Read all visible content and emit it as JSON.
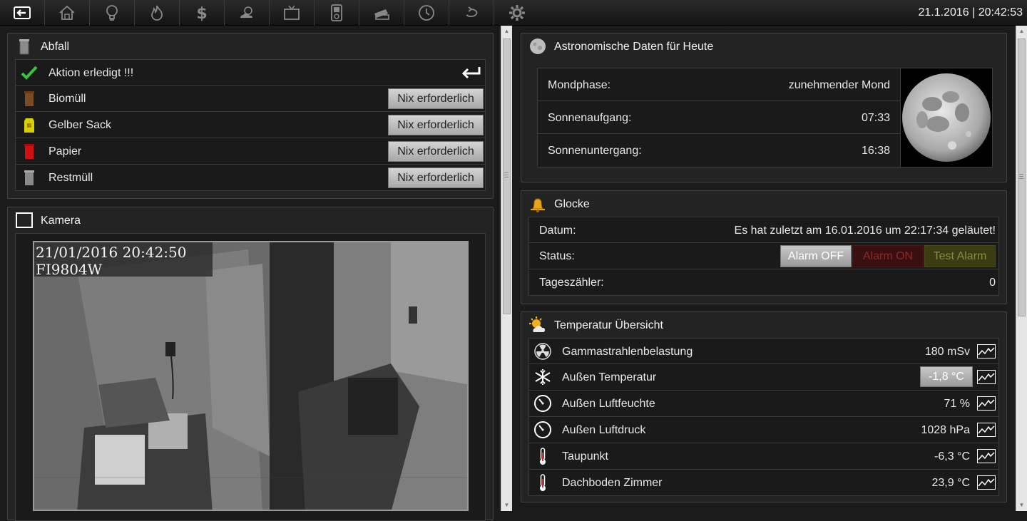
{
  "topbar": {
    "datetime": "21.1.2016 | 20:42:53",
    "nav": [
      "back-icon",
      "home-icon",
      "lightbulb-icon",
      "flame-icon",
      "dollar-icon",
      "weather-icon",
      "tv-icon",
      "media-player-icon",
      "tickets-icon",
      "clock-icon",
      "loop-icon",
      "gear-icon"
    ]
  },
  "abfall": {
    "title": "Abfall",
    "action_label": "Aktion erledigt !!!",
    "rows": [
      {
        "label": "Biomüll",
        "button": "Nix erforderlich",
        "color": "#7a4b24"
      },
      {
        "label": "Gelber Sack",
        "button": "Nix erforderlich",
        "color": "#d8d000"
      },
      {
        "label": "Papier",
        "button": "Nix erforderlich",
        "color": "#d01010"
      },
      {
        "label": "Restmüll",
        "button": "Nix erforderlich",
        "color": "#8a8a8a"
      }
    ]
  },
  "kamera": {
    "title": "Kamera",
    "overlay_line1": "21/01/2016 20:42:50",
    "overlay_line2": "FI9804W"
  },
  "astro": {
    "title": "Astronomische Daten für Heute",
    "rows": [
      {
        "label": "Mondphase:",
        "value": "zunehmender Mond"
      },
      {
        "label": "Sonnenaufgang:",
        "value": "07:33"
      },
      {
        "label": "Sonnenuntergang:",
        "value": "16:38"
      }
    ]
  },
  "glocke": {
    "title": "Glocke",
    "datum_label": "Datum:",
    "datum_value": "Es hat zuletzt am 16.01.2016 um 22:17:34 geläutet!",
    "status_label": "Status:",
    "btn_off": "Alarm OFF",
    "btn_on": "Alarm ON",
    "btn_test": "Test Alarm",
    "counter_label": "Tageszähler:",
    "counter_value": "0"
  },
  "temperatur": {
    "title": "Temperatur Übersicht",
    "rows": [
      {
        "label": "Gammastrahlenbelastung",
        "value": "180 mSv",
        "icon": "radiation-icon"
      },
      {
        "label": "Außen Temperatur",
        "value": "-1,8 °C",
        "icon": "snowflake-icon"
      },
      {
        "label": "Außen Luftfeuchte",
        "value": "71 %",
        "icon": "gauge-icon"
      },
      {
        "label": "Außen Luftdruck",
        "value": "1028 hPa",
        "icon": "gauge-icon"
      },
      {
        "label": "Taupunkt",
        "value": "-6,3 °C",
        "icon": "thermometer-icon"
      },
      {
        "label": "Dachboden Zimmer",
        "value": "23,9 °C",
        "icon": "thermometer-icon"
      }
    ]
  }
}
